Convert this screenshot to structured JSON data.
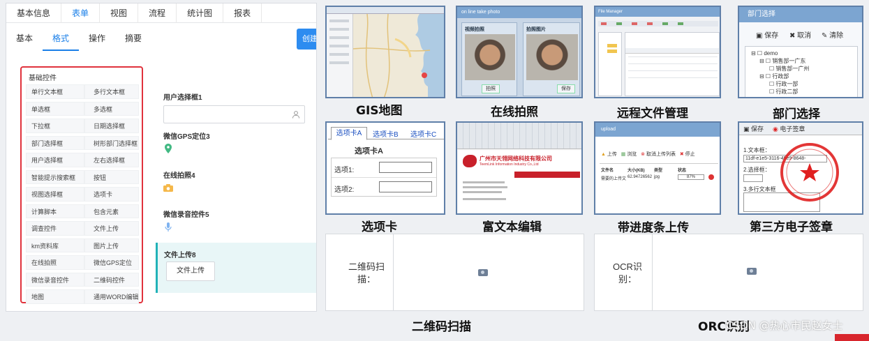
{
  "designer": {
    "top_tabs": [
      "基本信息",
      "表单",
      "视图",
      "流程",
      "统计图",
      "报表"
    ],
    "sub_tabs": [
      "基本",
      "格式",
      "操作",
      "摘要"
    ],
    "create_label": "创建",
    "controls_title": "基础控件",
    "controls": [
      "单行文本框",
      "多行文本框",
      "单选框",
      "多选框",
      "下拉框",
      "日期选择框",
      "部门选择框",
      "树形部门选择框",
      "用户选择框",
      "左右选择框",
      "智能提示搜索框",
      "按钮",
      "视图选择框",
      "选项卡",
      "计算脚本",
      "包含元素",
      "调查控件",
      "文件上传",
      "km资料库",
      "图片上传",
      "在线拍照",
      "微信GPS定位",
      "微信录音控件",
      "二维码控件",
      "地图",
      "通用WORD编辑器"
    ],
    "fields": {
      "user_select": "用户选择框1",
      "gps": "微信GPS定位3",
      "photo": "在线拍照4",
      "audio": "微信录音控件5",
      "upload": "文件上传8",
      "upload_button": "文件上传"
    }
  },
  "thumbs": {
    "gis_caption": "GIS地图",
    "photo_caption": "在线拍照",
    "photo_title": "on line take photo",
    "photo_left": "视频拍照",
    "photo_right": "拍照图片",
    "photo_btn1": "拍照",
    "photo_btn2": "保存",
    "file_caption": "远程文件管理",
    "file_title": "File Manager",
    "dept_caption": "部门选择",
    "dept_title": "部门选择",
    "dept_save": "保存",
    "dept_cancel": "取消",
    "dept_clear": "清除",
    "dept_tree": [
      "demo",
      "销售部一广东",
      "销售部一广州",
      "行政部",
      "行政一部",
      "行政二部"
    ],
    "tabs_caption": "选项卡",
    "tab_names": [
      "选项卡A",
      "选项卡B",
      "选项卡C"
    ],
    "tab_heading": "选项卡A",
    "tab_opt1": "选项1:",
    "tab_opt2": "选项2:",
    "rte_caption": "富文本编辑",
    "rte_company": "广州市天翎网络科技有限公司",
    "rte_company_en": "TeemLink Information Industry Co.,Ltd",
    "upload_caption": "带进度条上传",
    "upload_title": "upload",
    "upload_actions": [
      "上传",
      "浏览",
      "取消上传列表",
      "停止"
    ],
    "upload_cols": [
      "文件名",
      "大小(KB)",
      "类型",
      "状态"
    ],
    "upload_row": [
      "需要的上传文件.doc",
      "62.94726562",
      "jpg",
      "87%"
    ],
    "sign_caption": "第三方电子签章",
    "sign_save": "保存",
    "sign_stamp": "电子签章",
    "sign_f1": "1.文本框：",
    "sign_f1_val": "11df-e1e5-3116-49e9-8648-",
    "sign_f2": "2.选择框：",
    "sign_f3": "3.多行文本框",
    "qr_caption": "二维码扫描",
    "qr_label": "二维码扫描：",
    "ocr_caption": "ORC识别",
    "ocr_label": "OCR识别：",
    "watermark": "CSDN @热心市民赵女士"
  }
}
